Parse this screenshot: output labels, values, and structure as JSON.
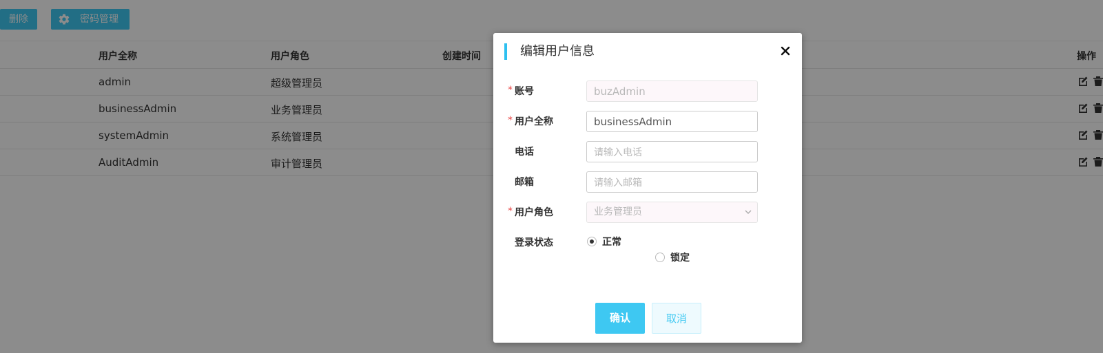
{
  "toolbar": {
    "delete_label": "删除",
    "password_label": "密码管理",
    "password_icon": "gear-icon"
  },
  "table": {
    "headers": [
      "用户全称",
      "用户角色",
      "创建时间",
      "操作"
    ],
    "rows": [
      {
        "full_name": "admin",
        "role": "超级管理员"
      },
      {
        "full_name": "businessAdmin",
        "role": "业务管理员"
      },
      {
        "full_name": "systemAdmin",
        "role": "系统管理员"
      },
      {
        "full_name": "AuditAdmin",
        "role": "审计管理员"
      }
    ],
    "row_actions": [
      "edit-icon",
      "trash-icon"
    ]
  },
  "modal": {
    "title": "编辑用户信息",
    "required_mark": "*",
    "fields": {
      "account": {
        "label": "账号",
        "value": "buzAdmin",
        "required": true,
        "disabled": true
      },
      "full_name": {
        "label": "用户全称",
        "value": "businessAdmin",
        "required": true
      },
      "phone": {
        "label": "电话",
        "value": "",
        "placeholder": "请输入电话"
      },
      "email": {
        "label": "邮箱",
        "value": "",
        "placeholder": "请输入邮箱"
      },
      "role": {
        "label": "用户角色",
        "value": "业务管理员",
        "required": true,
        "disabled": true
      },
      "login_status": {
        "label": "登录状态",
        "options": [
          "正常",
          "锁定"
        ],
        "selected": "正常"
      }
    },
    "confirm_label": "确认",
    "cancel_label": "取消"
  },
  "colors": {
    "accent": "#3ec8f2",
    "required": "#e84545",
    "overlay": "rgba(0,0,0,0.45)"
  }
}
